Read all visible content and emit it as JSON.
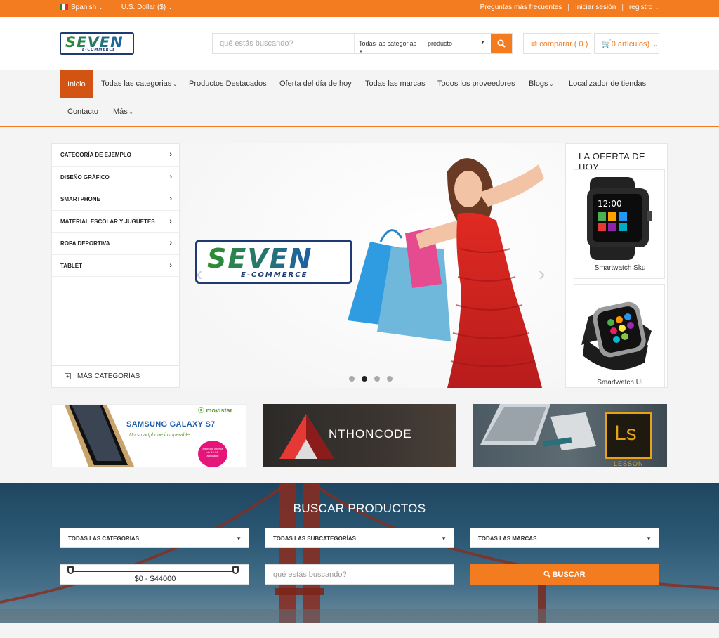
{
  "topbar": {
    "language": "Spanish",
    "currency": "U.S. Dollar ($)",
    "faq": "Preguntas más frecuentes",
    "login": "Iniciar sesión",
    "register": "registro",
    "separator": "|"
  },
  "header": {
    "logo_text": "SEVEN",
    "logo_sub": "E-COMMERCE",
    "search_placeholder": "qué estás buscando?",
    "category_select": "Todas las categorias",
    "type_select": "producto",
    "compare": "comparar ( 0 )",
    "cart": "0 artículos)"
  },
  "nav": {
    "items": [
      "Inicio",
      "Todas las categorias",
      "Productos Destacados",
      "Oferta del día de hoy",
      "Todas las marcas",
      "Todos los proveedores",
      "Blogs",
      "Localizador de tiendas",
      "Contacto",
      "Más"
    ]
  },
  "categories": {
    "items": [
      "CATEGORÍA DE EJEMPLO",
      "DISEÑO GRÁFICO",
      "SMARTPHONE",
      "MATERIAL ESCOLAR Y JUGUETES",
      "ROPA DEPORTIVA",
      "TABLET"
    ],
    "more": "MÁS CATEGORÍAS"
  },
  "slider": {
    "logo_text": "SEVEN",
    "logo_sub": "E-COMMERCE",
    "dots": 4,
    "active_dot": 2
  },
  "deal": {
    "title": "LA OFERTA DE HOY",
    "products": [
      "Smartwatch Sku",
      "Smartwatch UI"
    ]
  },
  "banners": {
    "b1_brand": "movistar",
    "b1_title": "SAMSUNG GALAXY S7",
    "b1_sub": "Un smartphone insuperable",
    "b1_badge": "Memoria interna de 32 GB ampliable",
    "b2_text": "NTHONCODE",
    "b3_text": "Ls",
    "b3_sub": "LESSON"
  },
  "product_search": {
    "title": "BUSCAR PRODUCTOS",
    "categories": "TODAS LAS CATEGORIAS",
    "subcategories": "TODAS LAS SUBCATEGORÍAS",
    "brands": "TODAS LAS MARCAS",
    "range": "$0 - $44000",
    "placeholder": "qué estás buscando?",
    "button": "BUSCAR"
  },
  "colors": {
    "accent": "#f47c20",
    "nav_active": "#d35412"
  }
}
